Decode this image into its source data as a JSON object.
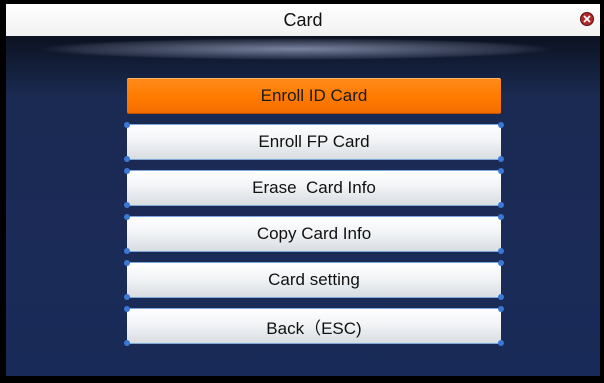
{
  "window": {
    "title": "Card",
    "close_icon": "close-icon",
    "colors": {
      "selected_bg": "#ff7a00",
      "screen_bg": "#1b2a52",
      "button_bg": "#f2f4f6"
    }
  },
  "menu": {
    "items": [
      {
        "label": "Enroll ID Card",
        "selected": true
      },
      {
        "label": "Enroll FP Card",
        "selected": false
      },
      {
        "label": "Erase  Card Info",
        "selected": false
      },
      {
        "label": "Copy Card Info",
        "selected": false
      },
      {
        "label": "Card setting",
        "selected": false
      },
      {
        "label": "Back（ESC)",
        "selected": false
      }
    ]
  }
}
